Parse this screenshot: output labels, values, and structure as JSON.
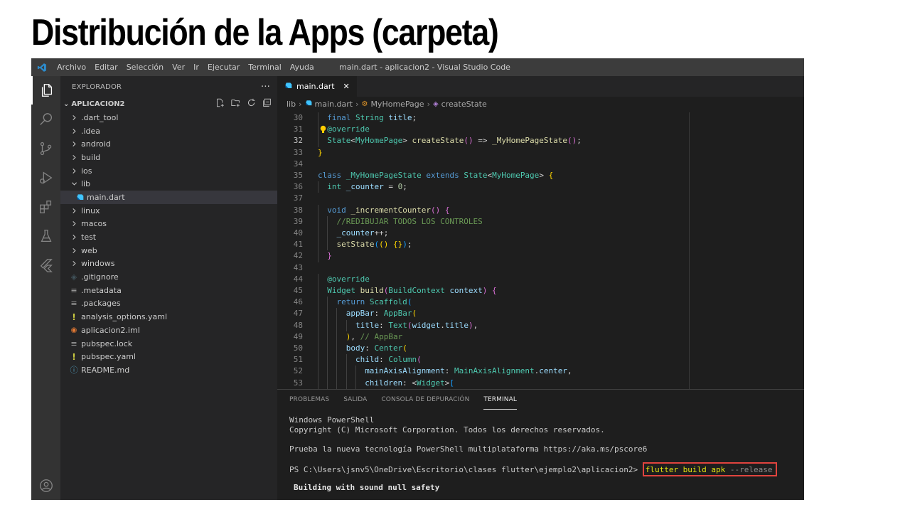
{
  "slide": {
    "title": "Distribución de la Apps (carpeta)"
  },
  "titlebar": {
    "menu": [
      "Archivo",
      "Editar",
      "Selección",
      "Ver",
      "Ir",
      "Ejecutar",
      "Terminal",
      "Ayuda"
    ],
    "window_title": "main.dart - aplicacion2 - Visual Studio Code"
  },
  "activitybar": {
    "items": [
      "explorer-icon",
      "search-icon",
      "source-control-icon",
      "run-debug-icon",
      "extensions-icon",
      "testing-icon",
      "flutter-icon",
      "account-icon"
    ]
  },
  "sidebar": {
    "header": "EXPLORADOR",
    "more": "···",
    "project": "APLICACION2",
    "items": [
      {
        "label": ".dart_tool",
        "type": "folder",
        "depth": 0,
        "open": false
      },
      {
        "label": ".idea",
        "type": "folder",
        "depth": 0,
        "open": false
      },
      {
        "label": "android",
        "type": "folder",
        "depth": 0,
        "open": false
      },
      {
        "label": "build",
        "type": "folder",
        "depth": 0,
        "open": false
      },
      {
        "label": "ios",
        "type": "folder",
        "depth": 0,
        "open": false
      },
      {
        "label": "lib",
        "type": "folder",
        "depth": 0,
        "open": true
      },
      {
        "label": "main.dart",
        "type": "dart",
        "depth": 1,
        "selected": true
      },
      {
        "label": "linux",
        "type": "folder",
        "depth": 0,
        "open": false
      },
      {
        "label": "macos",
        "type": "folder",
        "depth": 0,
        "open": false
      },
      {
        "label": "test",
        "type": "folder",
        "depth": 0,
        "open": false
      },
      {
        "label": "web",
        "type": "folder",
        "depth": 0,
        "open": false
      },
      {
        "label": "windows",
        "type": "folder",
        "depth": 0,
        "open": false
      },
      {
        "label": ".gitignore",
        "type": "git",
        "depth": 0
      },
      {
        "label": ".metadata",
        "type": "lines",
        "depth": 0
      },
      {
        "label": ".packages",
        "type": "lines",
        "depth": 0
      },
      {
        "label": "analysis_options.yaml",
        "type": "yaml",
        "depth": 0
      },
      {
        "label": "aplicacion2.iml",
        "type": "rss",
        "depth": 0
      },
      {
        "label": "pubspec.lock",
        "type": "lines",
        "depth": 0
      },
      {
        "label": "pubspec.yaml",
        "type": "yaml",
        "depth": 0
      },
      {
        "label": "README.md",
        "type": "info",
        "depth": 0
      }
    ]
  },
  "editor": {
    "tab": {
      "label": "main.dart",
      "close": "✕"
    },
    "breadcrumb": {
      "folder": "lib",
      "file": "main.dart",
      "class": "MyHomePage",
      "method": "createState"
    },
    "current_line": 32,
    "lines": [
      {
        "n": 30,
        "indent": 1,
        "segs": [
          [
            "kw",
            "final "
          ],
          [
            "ty",
            "String "
          ],
          [
            "vr",
            "title"
          ],
          [
            "pl",
            ";"
          ]
        ]
      },
      {
        "n": 31,
        "indent": 1,
        "segs": [
          [
            "an",
            "@override"
          ]
        ],
        "bulb": true
      },
      {
        "n": 32,
        "indent": 1,
        "segs": [
          [
            "ty",
            "State"
          ],
          [
            "pl",
            "<"
          ],
          [
            "ty",
            "MyHomePage"
          ],
          [
            "pl",
            "> "
          ],
          [
            "fn",
            "createState"
          ],
          [
            "br2",
            "()"
          ],
          [
            "pl",
            " => "
          ],
          [
            "fn",
            "_MyHomePageState"
          ],
          [
            "br2",
            "()"
          ],
          [
            "pl",
            ";"
          ]
        ]
      },
      {
        "n": 33,
        "indent": 0,
        "segs": [
          [
            "br1",
            "}"
          ]
        ]
      },
      {
        "n": 34,
        "indent": 0,
        "segs": []
      },
      {
        "n": 35,
        "indent": 0,
        "segs": [
          [
            "kw",
            "class "
          ],
          [
            "ty",
            "_MyHomePageState "
          ],
          [
            "kw",
            "extends "
          ],
          [
            "ty",
            "State"
          ],
          [
            "pl",
            "<"
          ],
          [
            "ty",
            "MyHomePage"
          ],
          [
            "pl",
            "> "
          ],
          [
            "br1",
            "{"
          ]
        ]
      },
      {
        "n": 36,
        "indent": 1,
        "segs": [
          [
            "ty",
            "int "
          ],
          [
            "vr",
            "_counter"
          ],
          [
            "pl",
            " = "
          ],
          [
            "nm",
            "0"
          ],
          [
            "pl",
            ";"
          ]
        ]
      },
      {
        "n": 37,
        "indent": 0,
        "segs": []
      },
      {
        "n": 38,
        "indent": 1,
        "segs": [
          [
            "kw",
            "void "
          ],
          [
            "fn",
            "_incrementCounter"
          ],
          [
            "br2",
            "() {"
          ]
        ]
      },
      {
        "n": 39,
        "indent": 2,
        "segs": [
          [
            "cm",
            "//REDIBUJAR TODOS LOS CONTROLES"
          ]
        ]
      },
      {
        "n": 40,
        "indent": 2,
        "segs": [
          [
            "vr",
            "_counter"
          ],
          [
            "pl",
            "++;"
          ]
        ]
      },
      {
        "n": 41,
        "indent": 2,
        "segs": [
          [
            "fn",
            "setState"
          ],
          [
            "br3",
            "("
          ],
          [
            "br1",
            "()"
          ],
          [
            "pl",
            " "
          ],
          [
            "br1",
            "{}"
          ],
          [
            "br3",
            ")"
          ],
          [
            "pl",
            ";"
          ]
        ]
      },
      {
        "n": 42,
        "indent": 1,
        "segs": [
          [
            "br2",
            "}"
          ]
        ]
      },
      {
        "n": 43,
        "indent": 0,
        "segs": []
      },
      {
        "n": 44,
        "indent": 1,
        "segs": [
          [
            "an",
            "@override"
          ]
        ]
      },
      {
        "n": 45,
        "indent": 1,
        "segs": [
          [
            "ty",
            "Widget "
          ],
          [
            "fn",
            "build"
          ],
          [
            "br2",
            "("
          ],
          [
            "ty",
            "BuildContext "
          ],
          [
            "vr",
            "context"
          ],
          [
            "br2",
            ")"
          ],
          [
            "pl",
            " "
          ],
          [
            "br2",
            "{"
          ]
        ]
      },
      {
        "n": 46,
        "indent": 2,
        "segs": [
          [
            "kw",
            "return "
          ],
          [
            "ty",
            "Scaffold"
          ],
          [
            "br3",
            "("
          ]
        ]
      },
      {
        "n": 47,
        "indent": 3,
        "segs": [
          [
            "vr",
            "appBar"
          ],
          [
            "pl",
            ": "
          ],
          [
            "ty",
            "AppBar"
          ],
          [
            "br1",
            "("
          ]
        ]
      },
      {
        "n": 48,
        "indent": 4,
        "segs": [
          [
            "vr",
            "title"
          ],
          [
            "pl",
            ": "
          ],
          [
            "ty",
            "Text"
          ],
          [
            "br2",
            "("
          ],
          [
            "vr",
            "widget"
          ],
          [
            "pl",
            "."
          ],
          [
            "vr",
            "title"
          ],
          [
            "br2",
            ")"
          ],
          [
            "pl",
            ","
          ]
        ]
      },
      {
        "n": 49,
        "indent": 3,
        "segs": [
          [
            "br1",
            ")"
          ],
          [
            "pl",
            ", "
          ],
          [
            "cm",
            "// AppBar"
          ]
        ]
      },
      {
        "n": 50,
        "indent": 3,
        "segs": [
          [
            "vr",
            "body"
          ],
          [
            "pl",
            ": "
          ],
          [
            "ty",
            "Center"
          ],
          [
            "br1",
            "("
          ]
        ]
      },
      {
        "n": 51,
        "indent": 4,
        "segs": [
          [
            "vr",
            "child"
          ],
          [
            "pl",
            ": "
          ],
          [
            "ty",
            "Column"
          ],
          [
            "br2",
            "("
          ]
        ]
      },
      {
        "n": 52,
        "indent": 5,
        "segs": [
          [
            "vr",
            "mainAxisAlignment"
          ],
          [
            "pl",
            ": "
          ],
          [
            "ty",
            "MainAxisAlignment"
          ],
          [
            "pl",
            "."
          ],
          [
            "vr",
            "center"
          ],
          [
            "pl",
            ","
          ]
        ]
      },
      {
        "n": 53,
        "indent": 5,
        "segs": [
          [
            "vr",
            "children"
          ],
          [
            "pl",
            ": <"
          ],
          [
            "ty",
            "Widget"
          ],
          [
            "pl",
            ">"
          ],
          [
            "br3",
            "["
          ]
        ]
      }
    ]
  },
  "panel": {
    "tabs": [
      "PROBLEMAS",
      "SALIDA",
      "CONSOLA DE DEPURACIÓN",
      "TERMINAL"
    ],
    "active_tab": "TERMINAL",
    "terminal": {
      "line1": "Windows PowerShell",
      "line2": "Copyright (C) Microsoft Corporation. Todos los derechos reservados.",
      "line3": "Prueba la nueva tecnología PowerShell multiplataforma https://aka.ms/pscore6",
      "prompt": "PS C:\\Users\\jsnv5\\OneDrive\\Escritorio\\clases flutter\\ejemplo2\\aplicacion2> ",
      "command_main": "flutter build apk ",
      "command_flag": "--release",
      "line5": "Building with sound null safety"
    }
  },
  "colors": {
    "accent_blue": "#2c8dcf",
    "highlight_box": "#e0443e"
  }
}
